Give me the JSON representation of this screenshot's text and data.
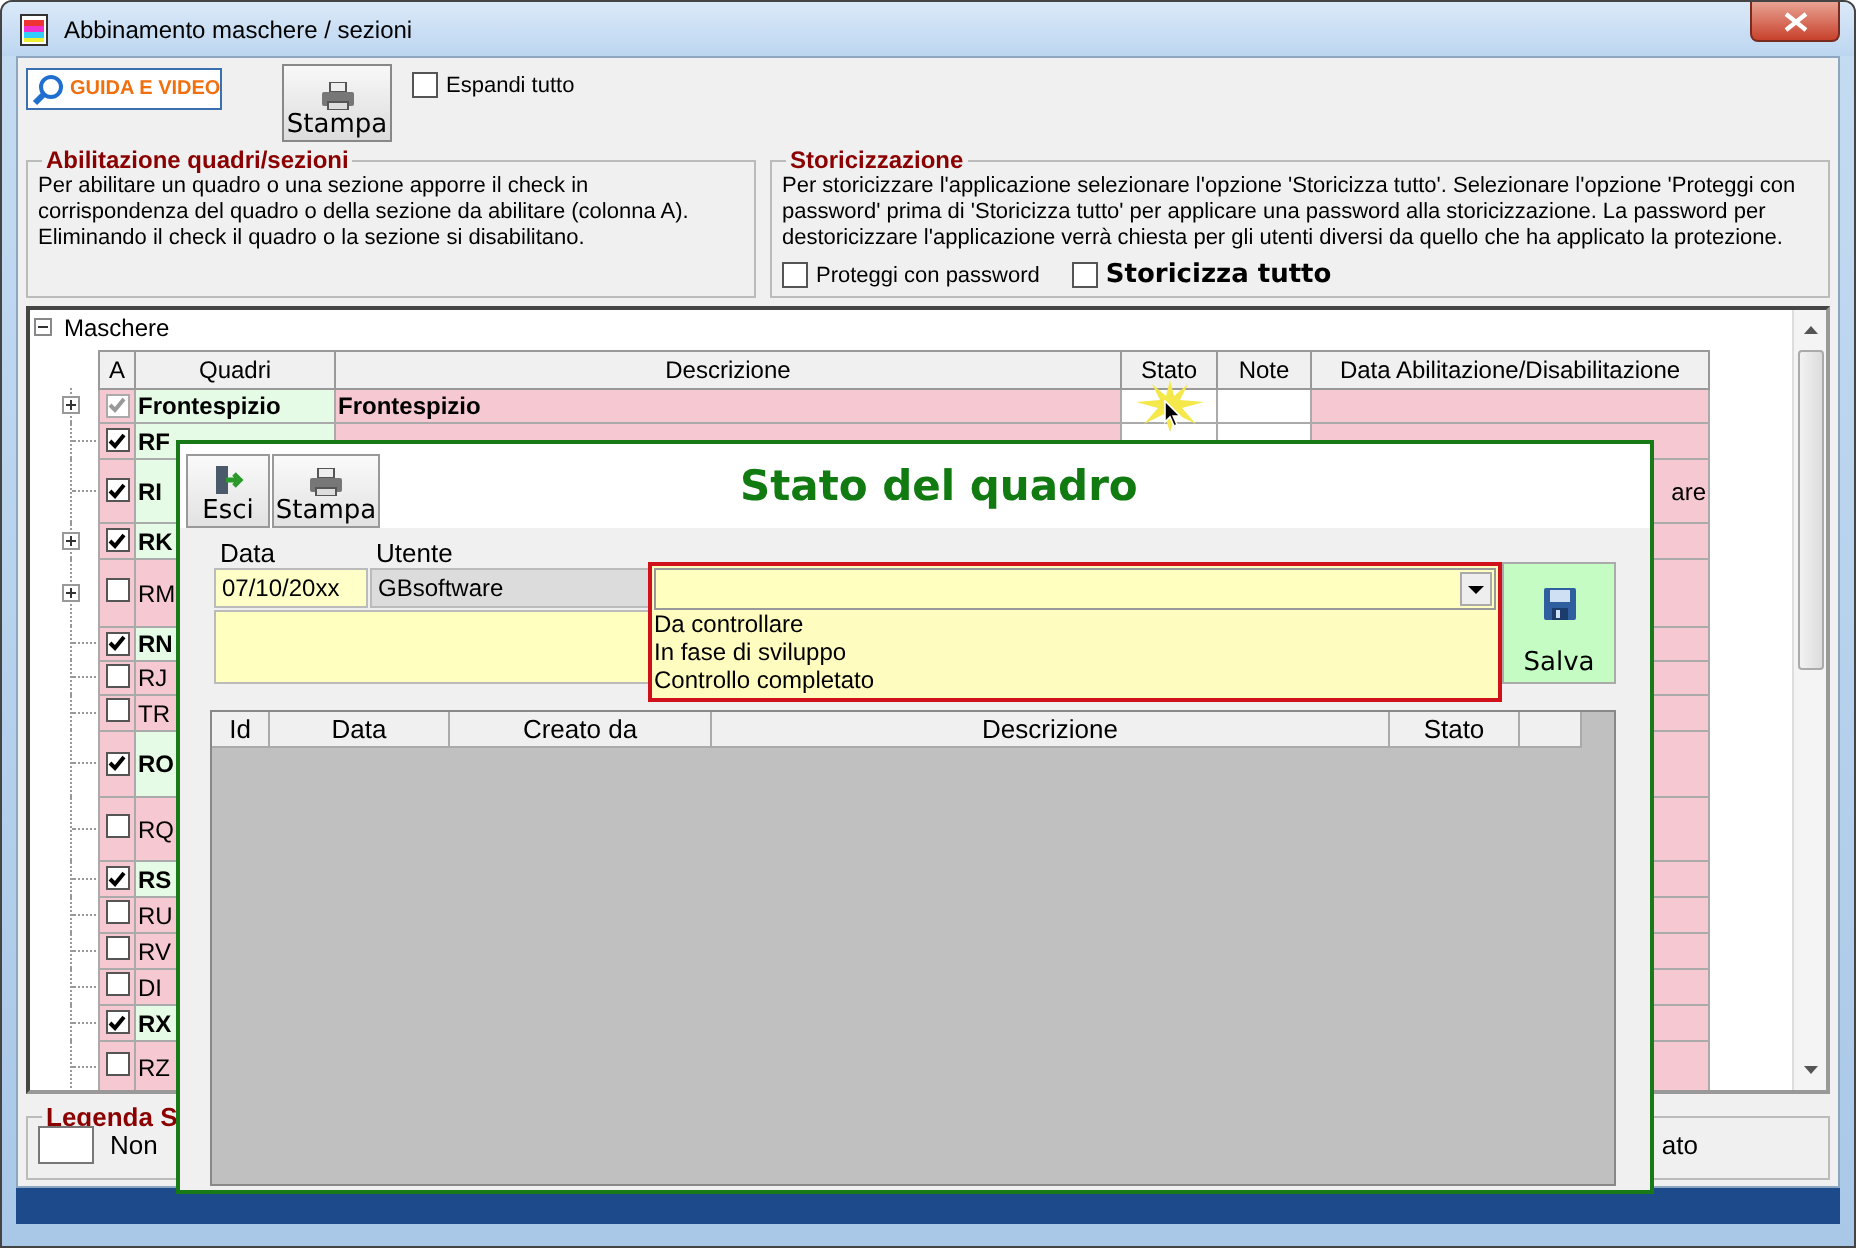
{
  "window": {
    "title": "Abbinamento maschere / sezioni"
  },
  "toolbar": {
    "guide_button": "GUIDA E VIDEO",
    "print_button": "Stampa",
    "expand_all": {
      "label": "Espandi tutto",
      "checked": false
    }
  },
  "abilitazione_group": {
    "title": "Abilitazione quadri/sezioni",
    "text": "Per abilitare un quadro o una sezione apporre il check in corrispondenza del quadro o della sezione da abilitare (colonna A). Eliminando il check il quadro o la sezione si disabilitano."
  },
  "storicizzazione_group": {
    "title": "Storicizzazione",
    "text": "Per storicizzare l'applicazione selezionare l'opzione 'Storicizza tutto'. Selezionare l'opzione 'Proteggi con password' prima di 'Storicizza tutto' per applicare una password alla storicizzazione. La password per destoricizzare l'applicazione verrà chiesta per gli utenti diversi da quello che ha applicato la protezione.",
    "protect": {
      "label": "Proteggi con password",
      "checked": false
    },
    "historicize_all": {
      "label": "Storicizza tutto",
      "checked": false
    }
  },
  "tree": {
    "root": {
      "label": "Maschere",
      "expanded": true
    },
    "columns": [
      "A",
      "Quadri",
      "Descrizione",
      "Stato",
      "Note",
      "Data Abilitazione/Disabilitazione"
    ],
    "rows": [
      {
        "code": "Frontespizio",
        "checked": true,
        "disabled": true,
        "expandable": true,
        "description": "Frontespizio"
      },
      {
        "code": "RF",
        "checked": true,
        "disabled": false,
        "expandable": false
      },
      {
        "code": "RI",
        "checked": true,
        "disabled": false,
        "expandable": false,
        "column_6": "are"
      },
      {
        "code": "RK",
        "checked": true,
        "disabled": false,
        "expandable": true
      },
      {
        "code": "RM",
        "checked": false,
        "disabled": false,
        "expandable": true
      },
      {
        "code": "RN",
        "checked": true,
        "disabled": false,
        "expandable": false
      },
      {
        "code": "RJ",
        "checked": false,
        "disabled": false,
        "expandable": false
      },
      {
        "code": "TR",
        "checked": false,
        "disabled": false,
        "expandable": false
      },
      {
        "code": "RO",
        "checked": true,
        "disabled": false,
        "expandable": false
      },
      {
        "code": "RQ",
        "checked": false,
        "disabled": false,
        "expandable": false
      },
      {
        "code": "RS",
        "checked": true,
        "disabled": false,
        "expandable": false
      },
      {
        "code": "RU",
        "checked": false,
        "disabled": false,
        "expandable": false
      },
      {
        "code": "RV",
        "checked": false,
        "disabled": false,
        "expandable": false
      },
      {
        "code": "DI",
        "checked": false,
        "disabled": false,
        "expandable": false
      },
      {
        "code": "RX",
        "checked": true,
        "disabled": false,
        "expandable": false
      },
      {
        "code": "RZ",
        "checked": false,
        "disabled": false,
        "expandable": false
      }
    ]
  },
  "legend": {
    "title": "Legenda S",
    "item_label": "Non",
    "column_2_fragment": "ato"
  },
  "dialog": {
    "title": "Stato del quadro",
    "buttons": [
      {
        "label": "Esci",
        "kind": "exit"
      },
      {
        "label": "Stampa",
        "kind": "print"
      }
    ],
    "data_label": "Data",
    "data_value": "07/10/20xx",
    "utente_label": "Utente",
    "utente_value": "GBsoftware",
    "stato_combo": {
      "expanded": true,
      "options": [
        "Da controllare",
        "In fase di sviluppo",
        "Controllo completato"
      ]
    },
    "save_button": "Salva",
    "grid": {
      "columns": [
        "Id",
        "Data",
        "Creato da",
        "Descrizione",
        "Stato"
      ]
    }
  }
}
